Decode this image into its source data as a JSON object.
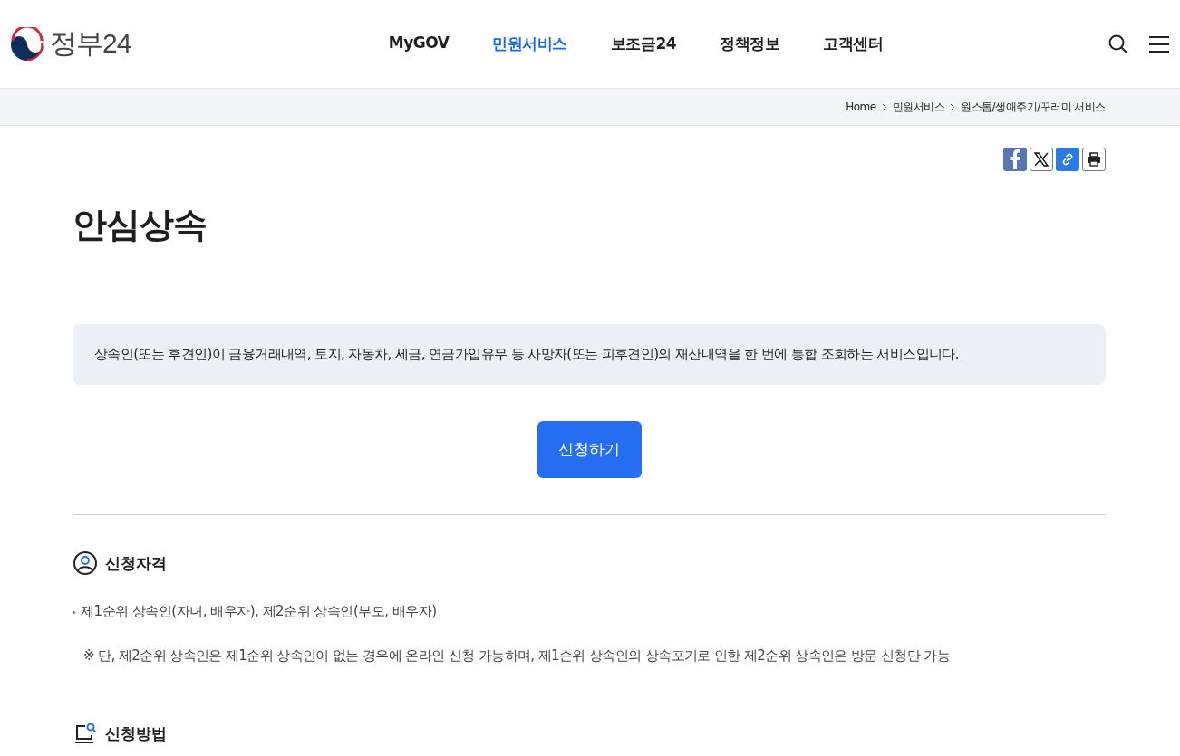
{
  "header": {
    "logo_text": "정부24",
    "nav": [
      {
        "label": "MyGOV",
        "selected": false
      },
      {
        "label": "민원서비스",
        "selected": true
      },
      {
        "label": "보조금24",
        "selected": false
      },
      {
        "label": "정책정보",
        "selected": false
      },
      {
        "label": "고객센터",
        "selected": false
      }
    ]
  },
  "breadcrumb": [
    "Home",
    "민원서비스",
    "원스톱/생애주기/꾸러미 서비스"
  ],
  "page_title": "안심상속",
  "summary": "상속인(또는 후견인)이 금융거래내역, 토지, 자동차, 세금, 연금가입유무 등 사망자(또는 피후견인)의 재산내역을 한 번에 통합 조회하는 서비스입니다.",
  "apply_button": "신청하기",
  "sections": [
    {
      "kind": "eligibility",
      "title": "신청자격",
      "bullets": [
        "제1순위 상속인(자녀, 배우자), 제2순위 상속인(부모, 배우자)"
      ],
      "note": "※ 단, 제2순위 상속인은 제1순위 상속인이 없는 경우에 온라인 신청 가능하며, 제1순위 상속인의 상속포기로 인한 제2순위 상속인은 방문 신청만 가능"
    },
    {
      "kind": "method",
      "title": "신청방법"
    }
  ]
}
